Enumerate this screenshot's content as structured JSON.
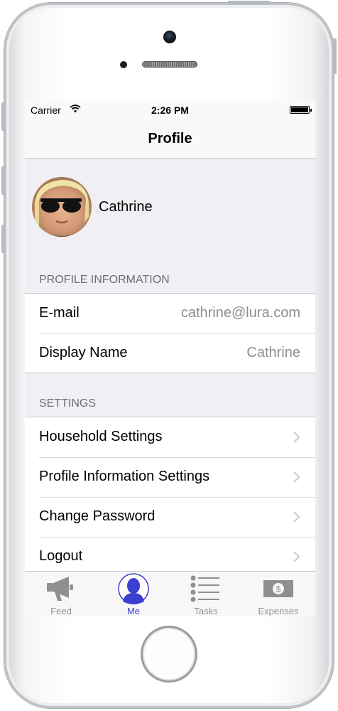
{
  "status_bar": {
    "carrier": "Carrier",
    "time": "2:26 PM"
  },
  "nav": {
    "title": "Profile"
  },
  "profile": {
    "name": "Cathrine",
    "avatar_icon": "user-photo"
  },
  "profile_information": {
    "header": "PROFILE INFORMATION",
    "rows": [
      {
        "label": "E-mail",
        "value": "cathrine@lura.com"
      },
      {
        "label": "Display Name",
        "value": "Cathrine"
      }
    ]
  },
  "settings": {
    "header": "SETTINGS",
    "rows": [
      {
        "label": "Household Settings"
      },
      {
        "label": "Profile Information Settings"
      },
      {
        "label": "Change Password"
      },
      {
        "label": "Logout"
      }
    ]
  },
  "tabs": [
    {
      "label": "Feed",
      "icon": "megaphone-icon",
      "active": false
    },
    {
      "label": "Me",
      "icon": "person-icon",
      "active": true
    },
    {
      "label": "Tasks",
      "icon": "list-icon",
      "active": false
    },
    {
      "label": "Expenses",
      "icon": "money-icon",
      "active": false
    }
  ],
  "colors": {
    "accent": "#3a3fcf",
    "background": "#efeff4",
    "secondary_text": "#8e8e93"
  }
}
